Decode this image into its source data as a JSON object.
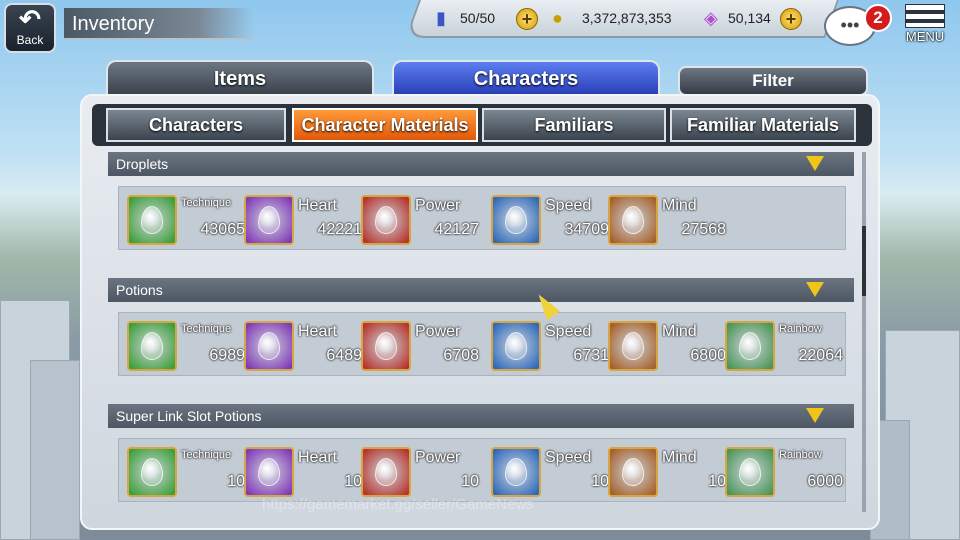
{
  "header": {
    "back_label": "Back",
    "title": "Inventory",
    "stamina": "50/50",
    "coins": "3,372,873,353",
    "gems": "50,134",
    "notifications": "2",
    "menu_label": "MENU",
    "chat_icon": "speech-bubble-icon"
  },
  "tabs": {
    "items": "Items",
    "characters": "Characters",
    "filter": "Filter",
    "active": "Characters"
  },
  "subtabs": [
    "Characters",
    "Character Materials",
    "Familiars",
    "Familiar Materials"
  ],
  "active_subtab": "Character Materials",
  "sections": [
    {
      "title": "Droplets",
      "items": [
        {
          "name": "Technique",
          "count": "43065",
          "color": "#2f9a2a",
          "icon": "green-droplet-icon"
        },
        {
          "name": "Heart",
          "count": "42221",
          "color": "#7a2bb3",
          "icon": "purple-droplet-icon"
        },
        {
          "name": "Power",
          "count": "42127",
          "color": "#b3261e",
          "icon": "red-droplet-icon"
        },
        {
          "name": "Speed",
          "count": "34709",
          "color": "#1f5fb8",
          "icon": "blue-droplet-icon"
        },
        {
          "name": "Mind",
          "count": "27568",
          "color": "#a2561a",
          "icon": "orange-droplet-icon"
        }
      ]
    },
    {
      "title": "Potions",
      "items": [
        {
          "name": "Technique",
          "count": "6989",
          "color": "#2f9a2a",
          "icon": "green-potion-icon"
        },
        {
          "name": "Heart",
          "count": "6489",
          "color": "#7a2bb3",
          "icon": "purple-potion-icon"
        },
        {
          "name": "Power",
          "count": "6708",
          "color": "#b3261e",
          "icon": "red-potion-icon"
        },
        {
          "name": "Speed",
          "count": "6731",
          "color": "#1f5fb8",
          "icon": "blue-potion-icon"
        },
        {
          "name": "Mind",
          "count": "6800",
          "color": "#a2561a",
          "icon": "orange-potion-icon"
        },
        {
          "name": "Rainbow",
          "count": "22064",
          "color": "#3f8f4a",
          "icon": "rainbow-potion-icon"
        }
      ]
    },
    {
      "title": "Super Link Slot Potions",
      "items": [
        {
          "name": "Technique",
          "count": "10",
          "color": "#2f9a2a",
          "icon": "green-slot-potion-icon"
        },
        {
          "name": "Heart",
          "count": "10",
          "color": "#7a2bb3",
          "icon": "purple-slot-potion-icon"
        },
        {
          "name": "Power",
          "count": "10",
          "color": "#b3261e",
          "icon": "red-slot-potion-icon"
        },
        {
          "name": "Speed",
          "count": "10",
          "color": "#1f5fb8",
          "icon": "blue-slot-potion-icon"
        },
        {
          "name": "Mind",
          "count": "10",
          "color": "#a2561a",
          "icon": "orange-slot-potion-icon"
        },
        {
          "name": "Rainbow",
          "count": "6000",
          "color": "#3f8f4a",
          "icon": "rainbow-slot-potion-icon"
        }
      ]
    }
  ],
  "watermark": "https://gamemarket.gg/seller/GameNews",
  "colors": {
    "active_tab": "#2a3fb8",
    "active_subtab": "#e1590a",
    "accent_gold": "#f0c419"
  }
}
